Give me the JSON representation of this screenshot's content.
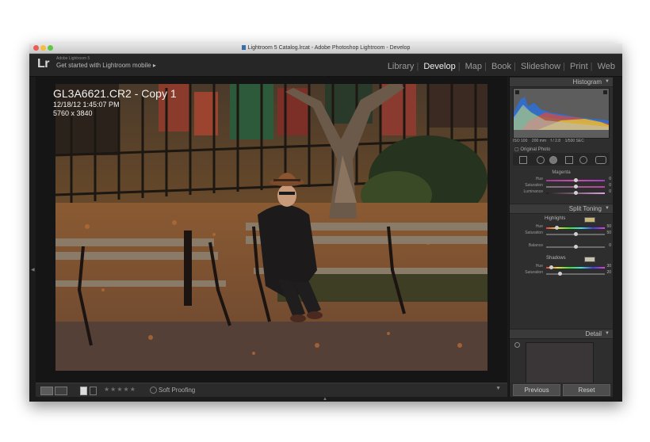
{
  "window": {
    "title": "Lightroom 5 Catalog.lrcat - Adobe Photoshop Lightroom - Develop"
  },
  "identity": {
    "logo": "Lr",
    "product": "Adobe Lightroom 5",
    "tagline": "Get started with Lightroom mobile",
    "tagline_arrow": "▸"
  },
  "modules": [
    {
      "label": "Library"
    },
    {
      "label": "Develop"
    },
    {
      "label": "Map"
    },
    {
      "label": "Book"
    },
    {
      "label": "Slideshow"
    },
    {
      "label": "Print"
    },
    {
      "label": "Web"
    }
  ],
  "active_module": "Develop",
  "photo_info": {
    "filename": "GL3A6621.CR2 - Copy 1",
    "datetime": "12/18/12 1:45:07 PM",
    "dimensions": "5760 x 3840"
  },
  "panel": {
    "histogram_title": "Histogram",
    "histogram_meta": {
      "iso": "ISO 100",
      "focal": "200 mm",
      "aperture": "f / 2.8",
      "shutter": "1/500 SEC"
    },
    "original_photo_label": "Original Photo",
    "hsl_color": "Magenta",
    "hsl_rows": [
      {
        "label": "Hue",
        "value": "0"
      },
      {
        "label": "Saturation",
        "value": "0"
      },
      {
        "label": "Luminance",
        "value": "0"
      }
    ],
    "split_toning_title": "Split Toning",
    "highlights_label": "Highlights",
    "highlights_rows": [
      {
        "label": "Hue",
        "value": "50"
      },
      {
        "label": "Saturation",
        "value": "50"
      }
    ],
    "balance_row": {
      "label": "Balance",
      "value": "0"
    },
    "shadows_label": "Shadows",
    "shadows_rows": [
      {
        "label": "Hue",
        "value": "30"
      },
      {
        "label": "Saturation",
        "value": "20"
      }
    ],
    "detail_title": "Detail",
    "previous_label": "Previous",
    "reset_label": "Reset"
  },
  "toolbar": {
    "stars": "★★★★★",
    "soft_proofing_label": "Soft Proofing",
    "dropdown": "▼"
  },
  "colors": {
    "highlights_swatch": "#c9b87a",
    "shadows_swatch": "#c7c3b0"
  }
}
